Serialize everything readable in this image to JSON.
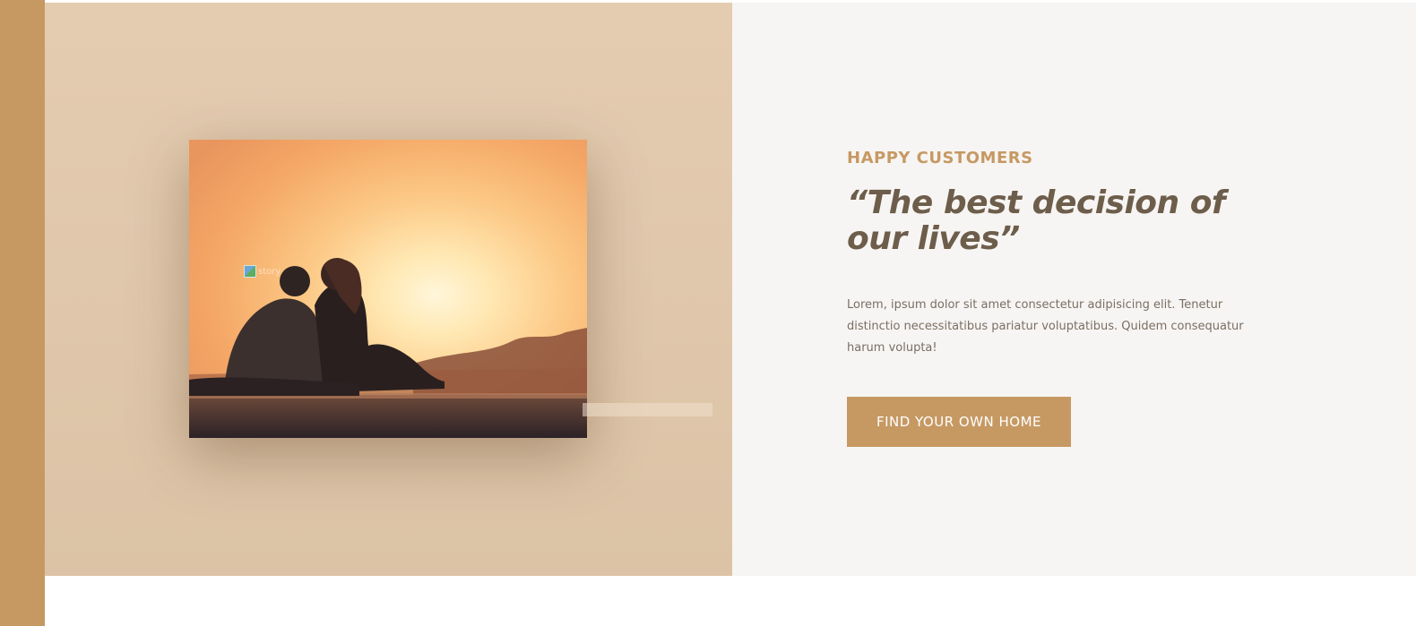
{
  "testimonial": {
    "eyebrow": "HAPPY CUSTOMERS",
    "quote": "“The best decision of our lives”",
    "body": "Lorem, ipsum dolor sit amet consectetur adipisicing elit. Tenetur distinctio necessitatibus pariatur voluptatibus. Quidem consequatur harum volupta!",
    "cta_label": "FIND YOUR OWN HOME"
  },
  "gallery": {
    "photo_icon": "couple-sunset-photo",
    "broken_image_alt": "story"
  },
  "colors": {
    "accent": "#c69963",
    "heading": "#6d5d4b",
    "section_bg": "#f7f5f3",
    "gallery_bg": "#e0c7ab"
  }
}
